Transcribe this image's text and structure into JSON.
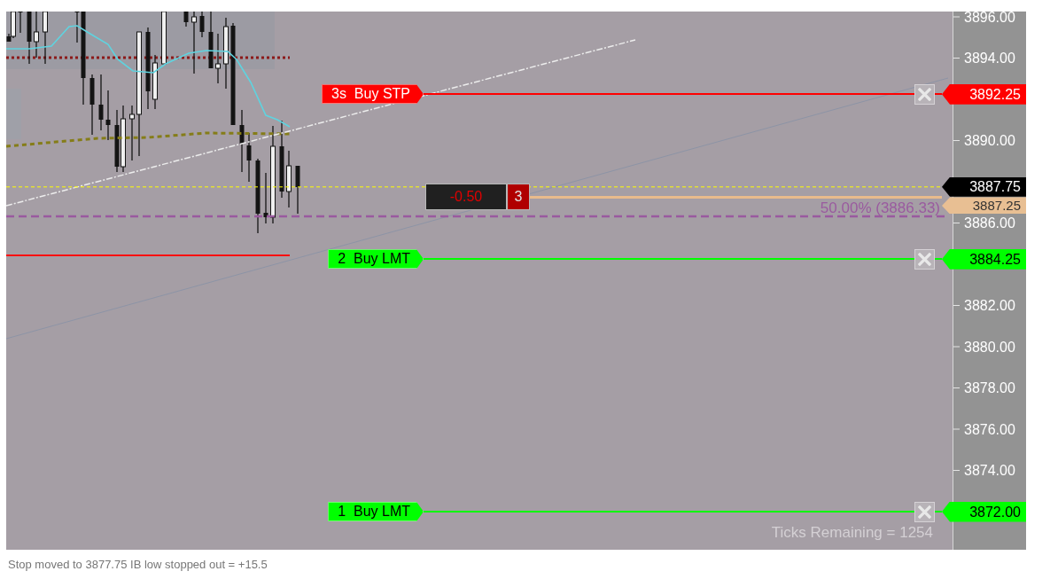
{
  "chart": {
    "orders": [
      {
        "kind": "stop",
        "label": "3s  Buy STP",
        "price": "3892.25"
      },
      {
        "kind": "limit",
        "label": "2  Buy LMT",
        "price": "3884.25"
      },
      {
        "kind": "limit",
        "label": "1  Buy LMT",
        "price": "3872.00"
      }
    ],
    "position": {
      "pnl": "-0.50",
      "quantity": "3",
      "average_price": "3887.25"
    },
    "last_price": "3887.75",
    "retracement_label": "50.00% (3886.33)",
    "ticks_remaining": "Ticks Remaining = 1254",
    "price_axis": {
      "labels": [
        "3896.00",
        "3894.00",
        "3890.00",
        "3886.00",
        "3882.00",
        "3880.00",
        "3878.00",
        "3876.00",
        "3874.00"
      ]
    }
  },
  "status_field": {
    "value": "Stop moved to 3877.75 IB low stopped out = +15.5"
  }
}
